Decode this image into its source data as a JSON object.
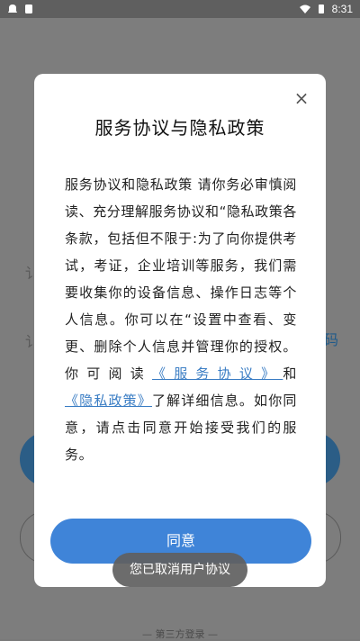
{
  "status_bar": {
    "time": "8:31",
    "left_icons": [
      "notification-icon",
      "sim-icon"
    ],
    "right_icons": [
      "wifi-icon",
      "battery-icon"
    ]
  },
  "background": {
    "partial_labels": [
      "讠",
      "讠"
    ],
    "partial_link": "码",
    "third_party_label": "— 第三方登录 —"
  },
  "dialog": {
    "title": "服务协议与隐私政策",
    "close_label": "×",
    "paragraph_1": "服务协议和隐私政策 请你务必审慎阅读、充分理解服务协议和“隐私政策各条款，包括但不限于:为了向你提供考试，考证，企业培训等服务，我们需要收集你的设备信息、操作日志等个人信息。你可以在“设置中查看、变更、删除个人信息并管理你的授权。",
    "paragraph_2_prefix": "你可阅读",
    "link_service": "《服务协议》",
    "and_text": "和",
    "link_privacy": "《隐私政策》",
    "paragraph_2_suffix": "了解详细信息。如你同意，请点击同意开始接受我们的服务。",
    "agree_label": "同意"
  },
  "toast": {
    "message": "您已取消用户协议"
  },
  "colors": {
    "accent": "#3f84d8",
    "link": "#3a7dc4"
  }
}
